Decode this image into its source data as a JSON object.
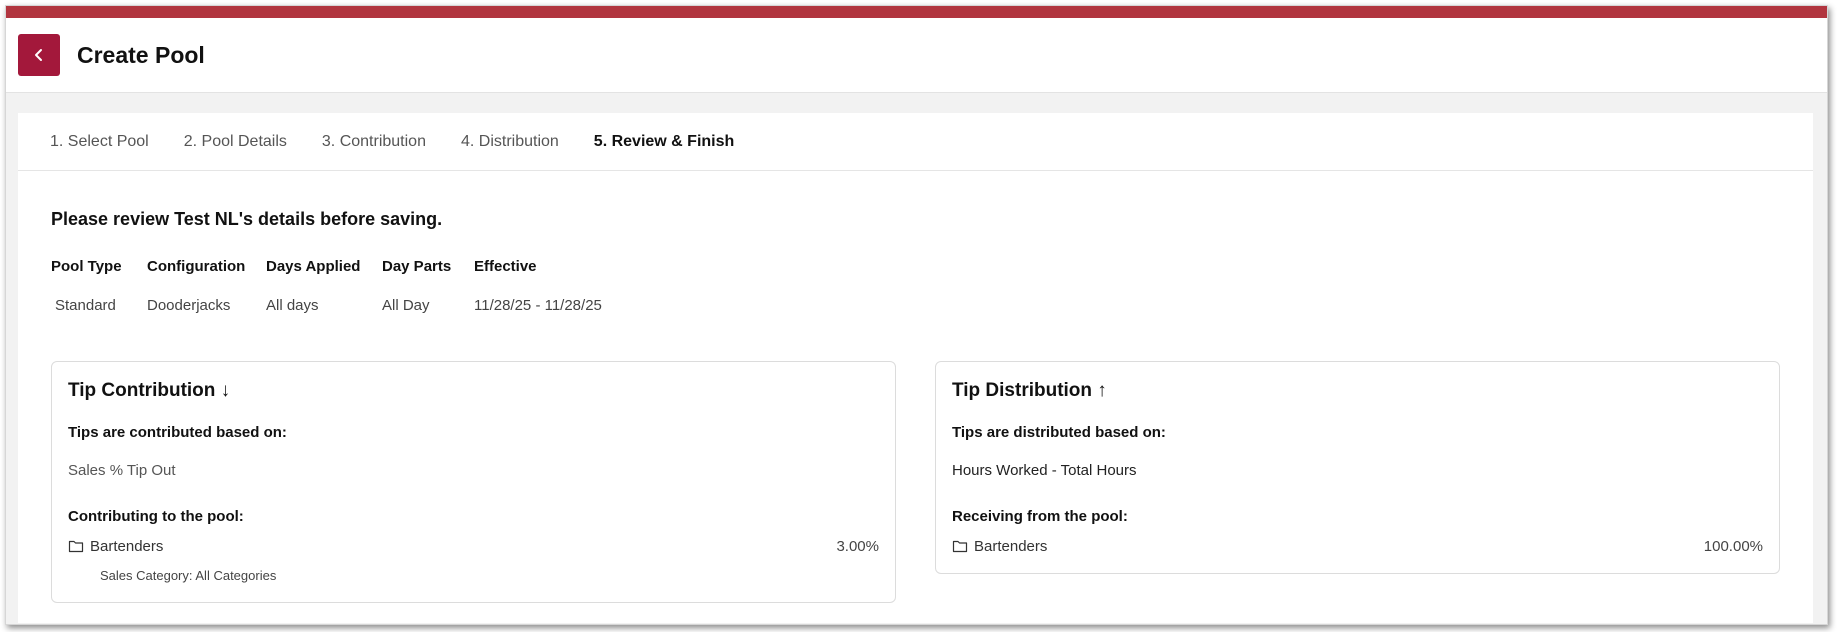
{
  "header": {
    "title": "Create Pool"
  },
  "tabs": [
    {
      "label": "1. Select Pool"
    },
    {
      "label": "2. Pool Details"
    },
    {
      "label": "3. Contribution"
    },
    {
      "label": "4. Distribution"
    },
    {
      "label": "5. Review & Finish"
    }
  ],
  "review": {
    "title": "Please review Test NL's details before saving.",
    "columns": [
      {
        "heading": "Pool Type",
        "value": "Standard"
      },
      {
        "heading": "Configuration",
        "value": "Dooderjacks"
      },
      {
        "heading": "Days Applied",
        "value": "All days"
      },
      {
        "heading": "Day Parts",
        "value": "All Day"
      },
      {
        "heading": "Effective",
        "value": "11/28/25 - 11/28/25"
      }
    ]
  },
  "contribution": {
    "title": "Tip Contribution ↓",
    "subtitle": "Tips are contributed based on:",
    "basis": "Sales % Tip Out",
    "pool_label": "Contributing to the pool:",
    "item": {
      "name": "Bartenders",
      "percent": "3.00%"
    },
    "category": "Sales Category: All Categories"
  },
  "distribution": {
    "title": "Tip Distribution ↑",
    "subtitle": "Tips are distributed based on:",
    "basis": "Hours Worked - Total Hours",
    "pool_label": "Receiving from the pool:",
    "item": {
      "name": "Bartenders",
      "percent": "100.00%"
    }
  },
  "colors": {
    "brand": "#a3183b",
    "topbar": "#b1353f"
  },
  "icons": {
    "back": "chevron-left-icon",
    "folder": "folder-icon"
  }
}
